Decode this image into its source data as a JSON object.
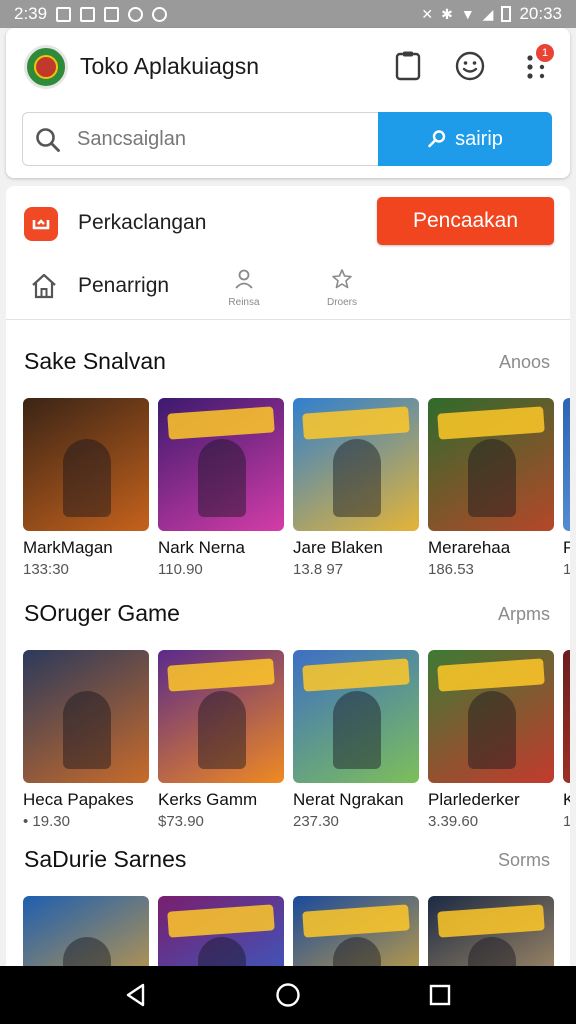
{
  "status_bar": {
    "time_left": "2:39",
    "time_right": "20:33"
  },
  "header": {
    "app_title": "Toko Aplakuiagsn",
    "notification_count": "1",
    "search": {
      "placeholder": "Sancsaiglan",
      "button_label": "sairip"
    }
  },
  "promo": {
    "label": "Perkaclangan",
    "button_label": "Pencaakan"
  },
  "nav_row": {
    "home_label": "Penarrign",
    "mini_items": [
      {
        "label": "Reinsa",
        "icon": "person-icon"
      },
      {
        "label": "Droers",
        "icon": "star-icon"
      }
    ]
  },
  "sections": [
    {
      "title": "Sake Snalvan",
      "more_label": "Anoos",
      "cards": [
        {
          "name": "MarkMagan",
          "sub": "133:30",
          "colors": [
            "#3a2416",
            "#c5621c"
          ]
        },
        {
          "name": "Nark Nerna",
          "sub": "110.90",
          "colors": [
            "#3b1a6e",
            "#d43da8"
          ]
        },
        {
          "name": "Jare Blaken",
          "sub": "13.8 97",
          "colors": [
            "#2f7fd0",
            "#e5b437"
          ]
        },
        {
          "name": "Merarehaa",
          "sub": "186.53",
          "colors": [
            "#2f6b2c",
            "#b5472a"
          ]
        },
        {
          "name": "P",
          "sub": "1",
          "colors": [
            "#2d64b3",
            "#6a9fe0"
          ]
        }
      ]
    },
    {
      "title": "SOruger Game",
      "more_label": "Arpms",
      "cards": [
        {
          "name": "Heca Papakes",
          "sub": "• 19.30",
          "colors": [
            "#2b3a5c",
            "#c96b2a"
          ]
        },
        {
          "name": "Kerks Gamm",
          "sub": "$73.90",
          "colors": [
            "#5a2a8a",
            "#f08a22"
          ]
        },
        {
          "name": "Nerat Ngrakan",
          "sub": "237.30",
          "colors": [
            "#3d6fc4",
            "#7dbf5a"
          ]
        },
        {
          "name": "Plarlederker",
          "sub": "3.39.60",
          "colors": [
            "#3d7a34",
            "#c43a2e"
          ]
        },
        {
          "name": "K",
          "sub": "1",
          "colors": [
            "#6a1e1e",
            "#b33a2a"
          ]
        }
      ]
    },
    {
      "title": "SaDurie Sarnes",
      "more_label": "Sorms",
      "cards": [
        {
          "name": "",
          "sub": "",
          "colors": [
            "#1e5fb0",
            "#e8a630"
          ]
        },
        {
          "name": "",
          "sub": "",
          "colors": [
            "#7a1e6e",
            "#2a6ad6"
          ]
        },
        {
          "name": "",
          "sub": "",
          "colors": [
            "#1b4a9c",
            "#f1b72c"
          ]
        },
        {
          "name": "",
          "sub": "",
          "colors": [
            "#1c2a44",
            "#c9a672"
          ]
        }
      ]
    }
  ],
  "colors": {
    "accent_blue": "#1e9be9",
    "accent_orange": "#f0451f",
    "badge_red": "#ea4335"
  }
}
